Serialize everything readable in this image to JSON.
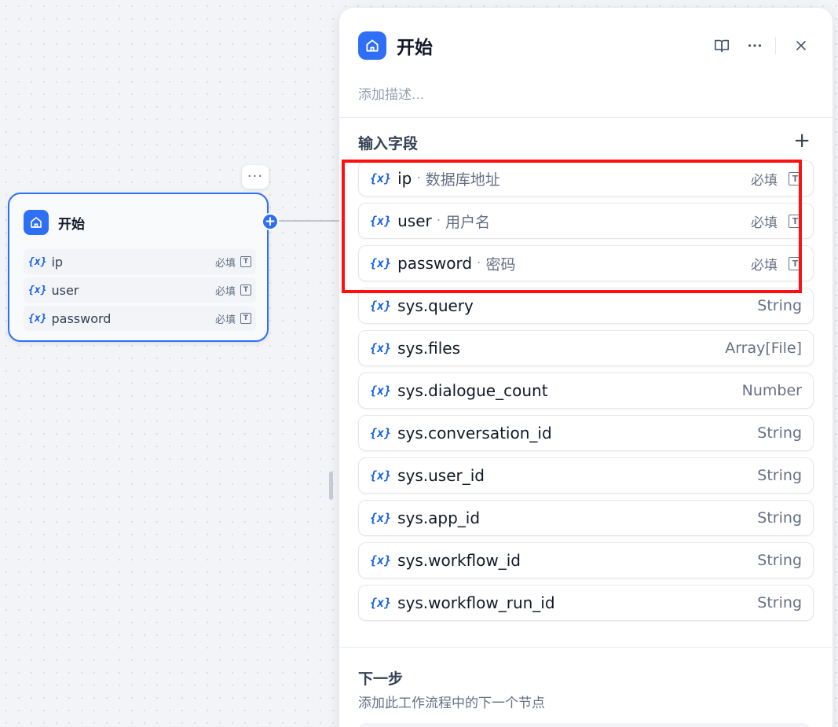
{
  "canvas_node": {
    "title": "开始",
    "icon": "home-icon",
    "more_icon": "···",
    "rows": [
      {
        "name": "ip",
        "required_label": "必填",
        "type_icon": "text-type-icon"
      },
      {
        "name": "user",
        "required_label": "必填",
        "type_icon": "text-type-icon"
      },
      {
        "name": "password",
        "required_label": "必填",
        "type_icon": "text-type-icon"
      }
    ],
    "connector_label": "+"
  },
  "var_glyph": "{x}",
  "panel": {
    "title": "开始",
    "icon": "home-icon",
    "header_actions": [
      "book-icon",
      "more-icon",
      "close-icon"
    ],
    "description_placeholder": "添加描述...",
    "input_section": {
      "title": "输入字段",
      "add_label": "+",
      "fields": [
        {
          "name": "ip",
          "label": "数据库地址",
          "required_label": "必填"
        },
        {
          "name": "user",
          "label": "用户名",
          "required_label": "必填"
        },
        {
          "name": "password",
          "label": "密码",
          "required_label": "必填"
        }
      ],
      "system_fields": [
        {
          "name": "sys.query",
          "type": "String"
        },
        {
          "name": "sys.files",
          "type": "Array[File]"
        },
        {
          "name": "sys.dialogue_count",
          "type": "Number"
        },
        {
          "name": "sys.conversation_id",
          "type": "String"
        },
        {
          "name": "sys.user_id",
          "type": "String"
        },
        {
          "name": "sys.app_id",
          "type": "String"
        },
        {
          "name": "sys.workflow_id",
          "type": "String"
        },
        {
          "name": "sys.workflow_run_id",
          "type": "String"
        }
      ]
    },
    "next_step": {
      "title": "下一步",
      "description": "添加此工作流程中的下一个节点"
    }
  },
  "colors": {
    "accent": "#2e6ff5",
    "highlight_border": "#ff1010"
  }
}
